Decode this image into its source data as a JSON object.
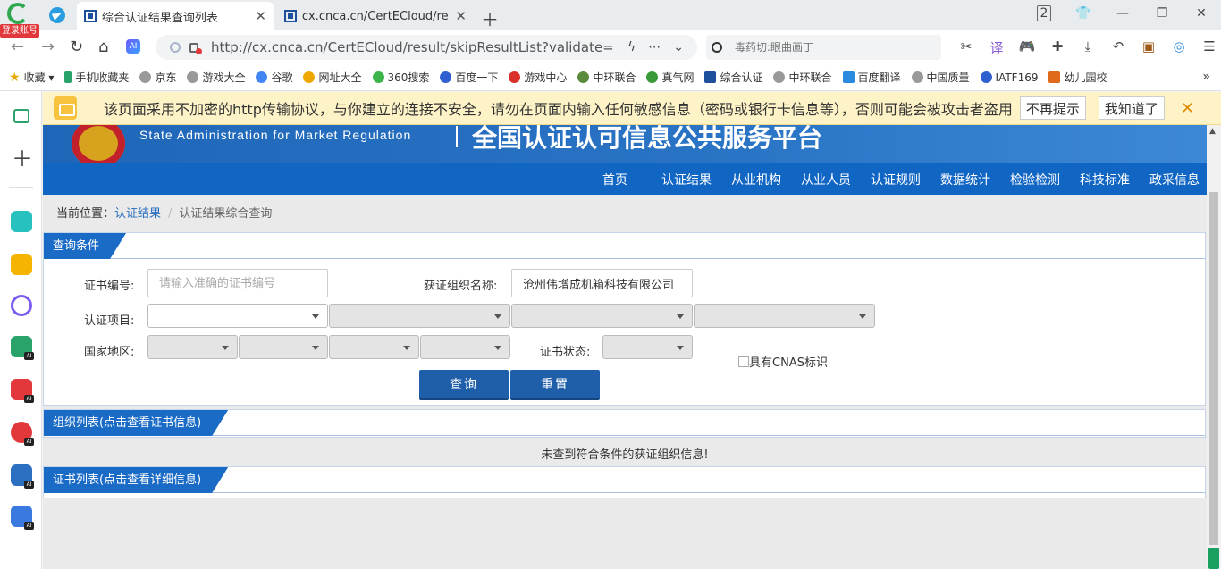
{
  "browser": {
    "login_badge": "登录账号",
    "tabs": [
      {
        "title": "综合认证结果查询列表",
        "active": true
      },
      {
        "title": "cx.cnca.cn/CertECloud/resul",
        "active": false
      }
    ],
    "tab_count": "2",
    "url": "http://cx.cnca.cn/CertECloud/result/skipResultList?validate=EJRN&",
    "search_placeholder": "毒药切:眼曲画丁",
    "bookmarks": [
      "收藏",
      "手机收藏夹",
      "京东",
      "游戏大全",
      "谷歌",
      "网址大全",
      "360搜索",
      "百度一下",
      "游戏中心",
      "中环联合",
      "真气网",
      "综合认证",
      "中环联合",
      "百度翻译",
      "中国质量",
      "IATF169",
      "幼儿园校"
    ]
  },
  "warning": {
    "text": "该页面采用不加密的http传输协议，与你建立的连接不安全，请勿在页面内输入任何敏感信息（密码或银行卡信息等），否则可能会被攻击者盗用",
    "btn_dismiss": "不再提示",
    "btn_ok": "我知道了"
  },
  "site": {
    "banner_en": "State Administration  for  Market Regulation",
    "banner_cn": "全国认证认可信息公共服务平台",
    "nav": [
      "首页",
      "认证结果",
      "从业机构",
      "从业人员",
      "认证规则",
      "数据统计",
      "检验检测",
      "科技标准",
      "政采信息"
    ]
  },
  "breadcrumb": {
    "prefix": "当前位置：",
    "link": "认证结果",
    "sep": "/",
    "current": "认证结果综合查询"
  },
  "query": {
    "title": "查询条件",
    "cert_no_label": "证书编号:",
    "cert_no_placeholder": "请输入准确的证书编号",
    "org_label": "获证组织名称:",
    "org_value": "沧州伟增成机箱科技有限公司",
    "project_label": "认证项目:",
    "region_label": "国家地区:",
    "status_label": "证书状态:",
    "cnas_label": "具有CNAS标识",
    "search_btn": "查询",
    "reset_btn": "重置"
  },
  "org_list": {
    "title": "组织列表(点击查看证书信息)",
    "empty": "未查到符合条件的获证组织信息!"
  },
  "cert_list": {
    "title": "证书列表(点击查看详细信息)"
  }
}
